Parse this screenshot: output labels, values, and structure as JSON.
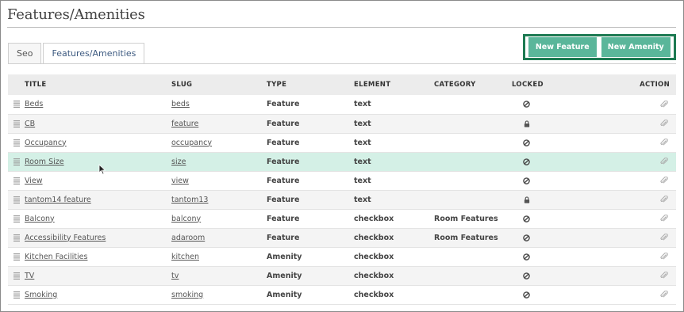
{
  "page": {
    "title": "Features/Amenities"
  },
  "tabs": [
    {
      "label": "Seo",
      "active": false
    },
    {
      "label": "Features/Amenities",
      "active": true
    }
  ],
  "buttons": {
    "new_feature": "New Feature",
    "new_amenity": "New Amenity"
  },
  "colors": {
    "button_bg": "#5ab69a",
    "button_group_border": "#1d7a52",
    "highlight_row": "#d4f0e6"
  },
  "table": {
    "headers": {
      "title": "TITLE",
      "slug": "SLUG",
      "type": "TYPE",
      "element": "ELEMENT",
      "category": "CATEGORY",
      "locked": "LOCKED",
      "action": "ACTION"
    },
    "rows": [
      {
        "title": "Beds",
        "slug": "beds",
        "type": "Feature",
        "element": "text",
        "category": "",
        "locked": "ban-icon"
      },
      {
        "title": "CB",
        "slug": "feature",
        "type": "Feature",
        "element": "text",
        "category": "",
        "locked": "lock-icon"
      },
      {
        "title": "Occupancy",
        "slug": "occupancy",
        "type": "Feature",
        "element": "text",
        "category": "",
        "locked": "ban-icon"
      },
      {
        "title": "Room Size",
        "slug": "size",
        "type": "Feature",
        "element": "text",
        "category": "",
        "locked": "ban-icon",
        "highlighted": true
      },
      {
        "title": "View",
        "slug": "view",
        "type": "Feature",
        "element": "text",
        "category": "",
        "locked": "ban-icon"
      },
      {
        "title": "tantom14 feature",
        "slug": "tantom13",
        "type": "Feature",
        "element": "text",
        "category": "",
        "locked": "lock-icon"
      },
      {
        "title": "Balcony",
        "slug": "balcony",
        "type": "Feature",
        "element": "checkbox",
        "category": "Room Features",
        "locked": "ban-icon"
      },
      {
        "title": "Accessibility Features",
        "slug": "adaroom",
        "type": "Feature",
        "element": "checkbox",
        "category": "Room Features",
        "locked": "ban-icon"
      },
      {
        "title": "Kitchen Facilities",
        "slug": "kitchen",
        "type": "Amenity",
        "element": "checkbox",
        "category": "",
        "locked": "ban-icon"
      },
      {
        "title": "TV",
        "slug": "tv",
        "type": "Amenity",
        "element": "checkbox",
        "category": "",
        "locked": "ban-icon"
      },
      {
        "title": "Smoking",
        "slug": "smoking",
        "type": "Amenity",
        "element": "checkbox",
        "category": "",
        "locked": "ban-icon"
      }
    ]
  }
}
